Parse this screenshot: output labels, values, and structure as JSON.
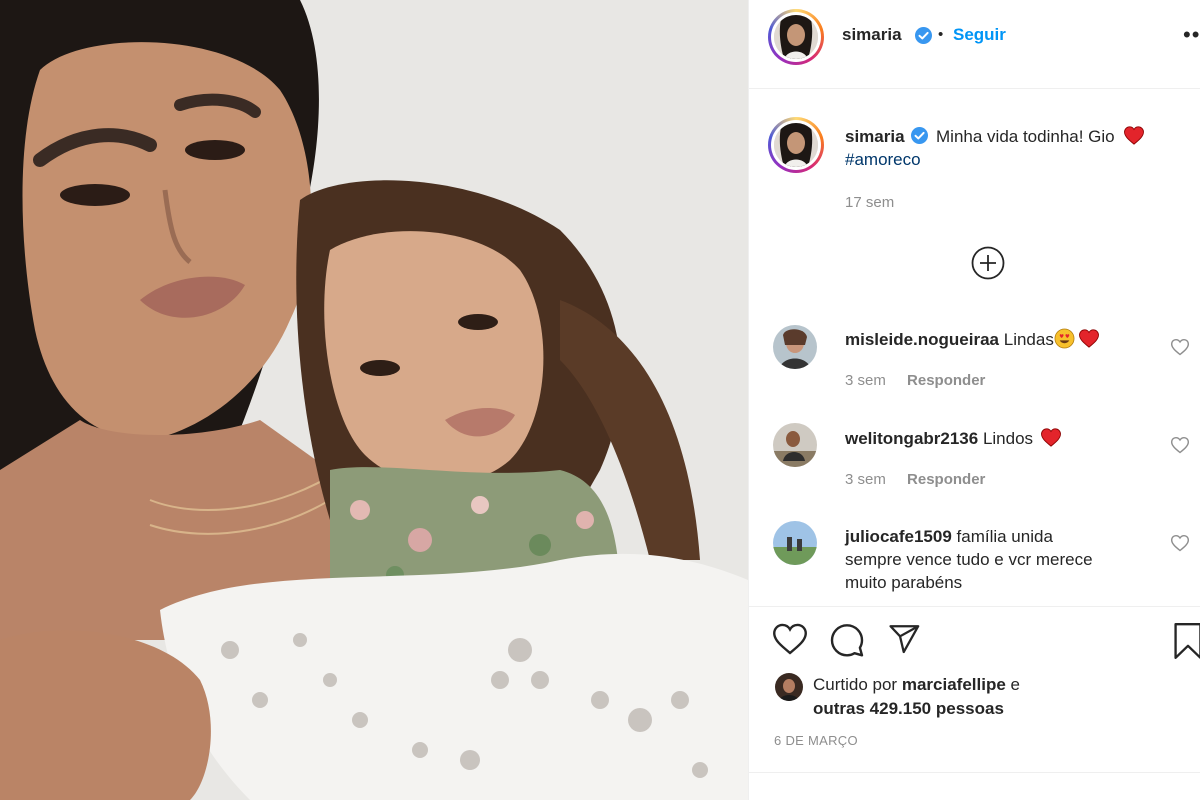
{
  "header": {
    "username": "simaria",
    "follow_separator": "•",
    "follow_label": "Seguir",
    "more_icon": "more-horizontal-icon"
  },
  "caption": {
    "username": "simaria",
    "text": "Minha vida todinha! Gio",
    "hashtag": "#amoreco",
    "time": "17 sem"
  },
  "load_more_icon": "plus-circle-icon",
  "comments": [
    {
      "username": "misleide.nogueiraa",
      "text": "Lindas",
      "time": "3 sem",
      "reply": "Responder"
    },
    {
      "username": "welitongabr2136",
      "text": "Lindos",
      "time": "3 sem",
      "reply": "Responder"
    },
    {
      "username": "juliocafe1509",
      "text_lines": [
        "família unida",
        "sempre vence tudo e vcr merece",
        "muito parabéns"
      ]
    }
  ],
  "actions": {
    "like_icon": "heart-outline-icon",
    "comment_icon": "comment-icon",
    "share_icon": "paper-plane-icon",
    "save_icon": "bookmark-icon"
  },
  "likes": {
    "prefix": "Curtido por",
    "user": "marciafellipe",
    "conjunction": "e",
    "others": "outras 429.150 pessoas"
  },
  "date": "6 DE MARÇO",
  "colors": {
    "link_blue": "#0095f6",
    "verified_blue": "#3897f0",
    "heart_red": "#ed4956",
    "muted_gray": "#8e8e8e"
  }
}
